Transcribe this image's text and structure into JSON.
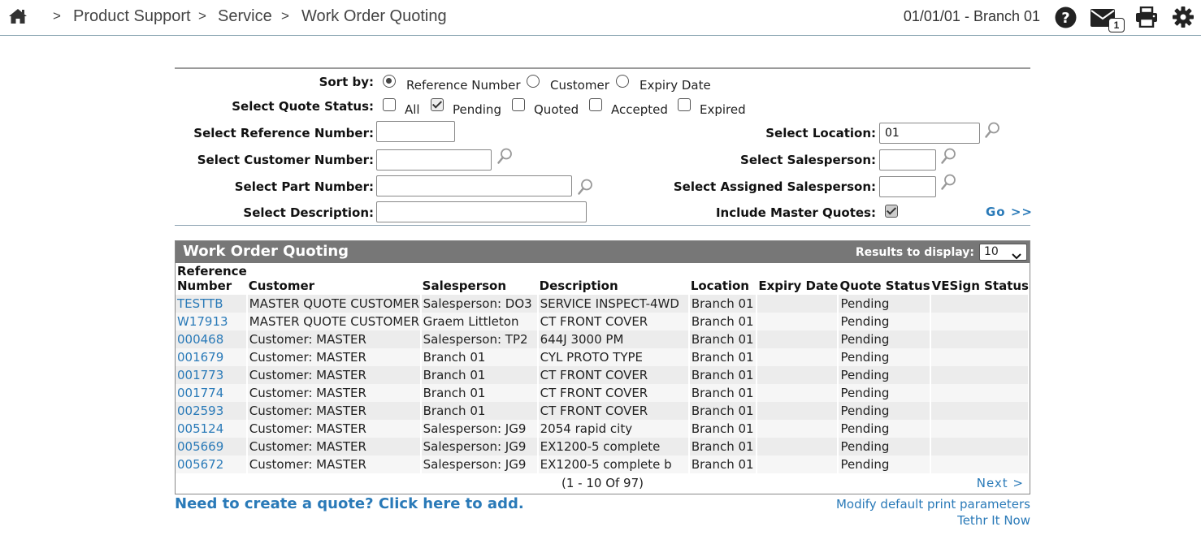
{
  "breadcrumb": {
    "items": [
      "Product Support",
      "Service",
      "Work Order Quoting"
    ],
    "separator": ">"
  },
  "header": {
    "date_branch": "01/01/01 - Branch 01",
    "mail_count": "1",
    "icons": [
      "home-icon",
      "help-icon",
      "mail-icon",
      "print-icon",
      "gear-icon"
    ]
  },
  "filters": {
    "sort_by": {
      "label": "Sort by:",
      "options": [
        "Reference Number",
        "Customer",
        "Expiry Date"
      ],
      "selected": "Reference Number"
    },
    "quote_status": {
      "label": "Select Quote Status:",
      "options": [
        "All",
        "Pending",
        "Quoted",
        "Accepted",
        "Expired"
      ],
      "checked": [
        "Pending"
      ]
    },
    "reference_number": {
      "label": "Select Reference Number:",
      "value": ""
    },
    "customer_number": {
      "label": "Select Customer Number:",
      "value": ""
    },
    "part_number": {
      "label": "Select Part Number:",
      "value": ""
    },
    "description": {
      "label": "Select Description:",
      "value": ""
    },
    "location": {
      "label": "Select Location:",
      "value": "01"
    },
    "salesperson": {
      "label": "Select Salesperson:",
      "value": ""
    },
    "assigned_salesperson": {
      "label": "Select Assigned Salesperson:",
      "value": ""
    },
    "include_master": {
      "label": "Include Master Quotes:",
      "checked": true
    },
    "go_label": "Go >>"
  },
  "results": {
    "title": "Work Order Quoting",
    "results_to_display_label": "Results to display:",
    "results_to_display_value": "10",
    "columns": [
      "Reference\nNumber",
      "Customer",
      "Salesperson",
      "Description",
      "Location",
      "Expiry Date",
      "Quote Status",
      "VESign Status"
    ],
    "rows": [
      [
        "TESTTB",
        "MASTER QUOTE CUSTOMER",
        "Salesperson: DO3",
        "SERVICE INSPECT-4WD",
        "Branch 01",
        "",
        "Pending",
        ""
      ],
      [
        "W17913",
        "MASTER QUOTE CUSTOMER",
        "Graem Littleton",
        "CT FRONT COVER",
        "Branch 01",
        "",
        "Pending",
        ""
      ],
      [
        "000468",
        "Customer: MASTER",
        "Salesperson: TP2",
        "644J 3000 PM",
        "Branch 01",
        "",
        "Pending",
        ""
      ],
      [
        "001679",
        "Customer: MASTER",
        "Branch 01",
        "CYL PROTO TYPE",
        "Branch 01",
        "",
        "Pending",
        ""
      ],
      [
        "001773",
        "Customer: MASTER",
        "Branch 01",
        "CT FRONT COVER",
        "Branch 01",
        "",
        "Pending",
        ""
      ],
      [
        "001774",
        "Customer: MASTER",
        "Branch 01",
        "CT FRONT COVER",
        "Branch 01",
        "",
        "Pending",
        ""
      ],
      [
        "002593",
        "Customer: MASTER",
        "Branch 01",
        "CT FRONT COVER",
        "Branch 01",
        "",
        "Pending",
        ""
      ],
      [
        "005124",
        "Customer: MASTER",
        "Salesperson: JG9",
        "2054 rapid city",
        "Branch 01",
        "",
        "Pending",
        ""
      ],
      [
        "005669",
        "Customer: MASTER",
        "Salesperson: JG9",
        "EX1200-5 complete",
        "Branch 01",
        "",
        "Pending",
        ""
      ],
      [
        "005672",
        "Customer: MASTER",
        "Salesperson: JG9",
        "EX1200-5 complete b",
        "Branch 01",
        "",
        "Pending",
        ""
      ]
    ],
    "pager_text": "(1 - 10 Of 97)",
    "next_label": "Next >"
  },
  "footer": {
    "add_quote": "Need to create a quote? Click here to add.",
    "print_params": "Modify default print parameters",
    "tethr": "Tethr It Now"
  },
  "colors": {
    "link": "#2a7ab8",
    "panel_header": "#777777",
    "row_odd": "#ececec",
    "row_even": "#f6f6f6"
  }
}
